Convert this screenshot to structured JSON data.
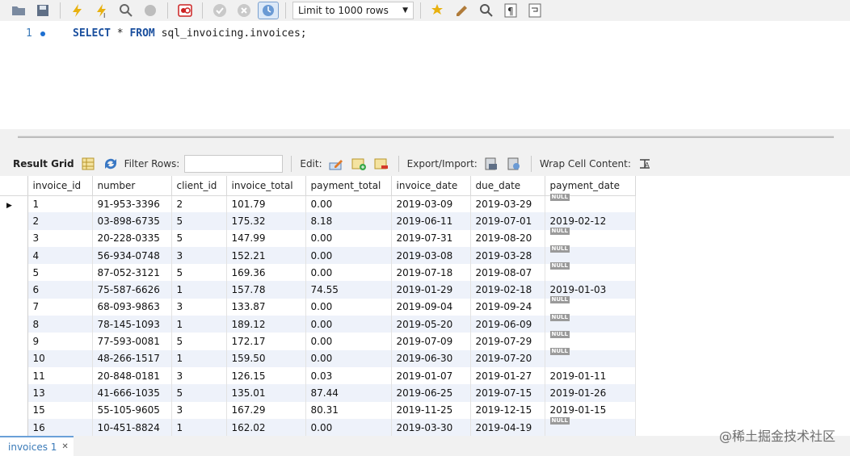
{
  "toolbar": {
    "limit_label": "Limit to 1000 rows",
    "icons": [
      "open-folder-icon",
      "save-icon",
      "execute-icon",
      "execute-selection-icon",
      "explain-icon",
      "stop-icon",
      "toggle-error-icon",
      "commit-icon",
      "rollback-icon",
      "autocommit-icon",
      "limit-dropdown",
      "bookmark-icon",
      "beautify-icon",
      "find-icon",
      "invisible-chars-icon",
      "wrap-icon"
    ]
  },
  "editor": {
    "line_number": "1",
    "keyword_select": "SELECT",
    "star": " * ",
    "keyword_from": "FROM",
    "rest": " sql_invoicing.invoices;"
  },
  "results_toolbar": {
    "result_grid": "Result Grid",
    "filter_rows": "Filter Rows:",
    "edit": "Edit:",
    "export_import": "Export/Import:",
    "wrap": "Wrap Cell Content:"
  },
  "grid": {
    "columns": [
      "invoice_id",
      "number",
      "client_id",
      "invoice_total",
      "payment_total",
      "invoice_date",
      "due_date",
      "payment_date"
    ],
    "rows": [
      [
        "1",
        "91-953-3396",
        "2",
        "101.79",
        "0.00",
        "2019-03-09",
        "2019-03-29",
        "NULL"
      ],
      [
        "2",
        "03-898-6735",
        "5",
        "175.32",
        "8.18",
        "2019-06-11",
        "2019-07-01",
        "2019-02-12"
      ],
      [
        "3",
        "20-228-0335",
        "5",
        "147.99",
        "0.00",
        "2019-07-31",
        "2019-08-20",
        "NULL"
      ],
      [
        "4",
        "56-934-0748",
        "3",
        "152.21",
        "0.00",
        "2019-03-08",
        "2019-03-28",
        "NULL"
      ],
      [
        "5",
        "87-052-3121",
        "5",
        "169.36",
        "0.00",
        "2019-07-18",
        "2019-08-07",
        "NULL"
      ],
      [
        "6",
        "75-587-6626",
        "1",
        "157.78",
        "74.55",
        "2019-01-29",
        "2019-02-18",
        "2019-01-03"
      ],
      [
        "7",
        "68-093-9863",
        "3",
        "133.87",
        "0.00",
        "2019-09-04",
        "2019-09-24",
        "NULL"
      ],
      [
        "8",
        "78-145-1093",
        "1",
        "189.12",
        "0.00",
        "2019-05-20",
        "2019-06-09",
        "NULL"
      ],
      [
        "9",
        "77-593-0081",
        "5",
        "172.17",
        "0.00",
        "2019-07-09",
        "2019-07-29",
        "NULL"
      ],
      [
        "10",
        "48-266-1517",
        "1",
        "159.50",
        "0.00",
        "2019-06-30",
        "2019-07-20",
        "NULL"
      ],
      [
        "11",
        "20-848-0181",
        "3",
        "126.15",
        "0.03",
        "2019-01-07",
        "2019-01-27",
        "2019-01-11"
      ],
      [
        "13",
        "41-666-1035",
        "5",
        "135.01",
        "87.44",
        "2019-06-25",
        "2019-07-15",
        "2019-01-26"
      ],
      [
        "15",
        "55-105-9605",
        "3",
        "167.29",
        "80.31",
        "2019-11-25",
        "2019-12-15",
        "2019-01-15"
      ],
      [
        "16",
        "10-451-8824",
        "1",
        "162.02",
        "0.00",
        "2019-03-30",
        "2019-04-19",
        "NULL"
      ]
    ]
  },
  "bottom": {
    "tab_label": "invoices 1",
    "close": "✕"
  },
  "watermark": "@稀土掘金技术社区",
  "colors": {
    "accent": "#1d6fd1",
    "alt_row": "#eef2fa",
    "null_badge": "#9a9a9a"
  }
}
